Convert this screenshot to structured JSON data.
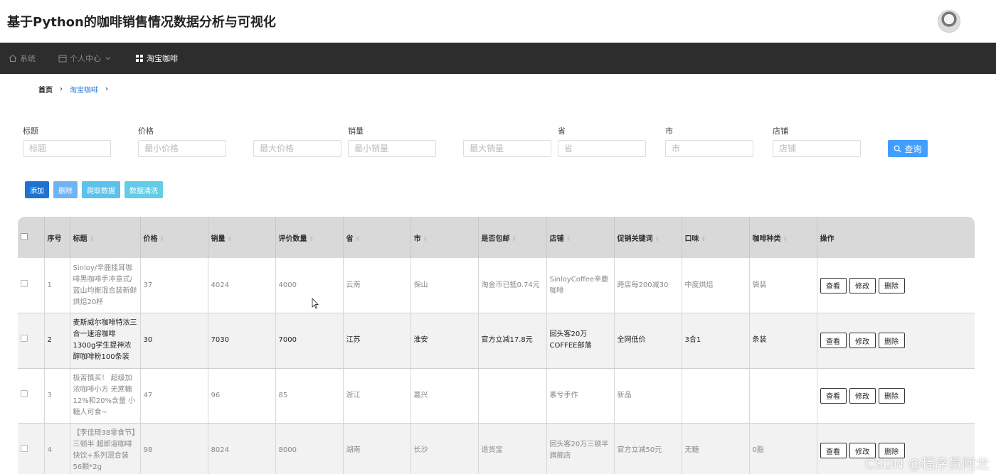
{
  "app": {
    "title": "基于Python的咖啡销售情况数据分析与可视化"
  },
  "nav": {
    "items": [
      {
        "label": "系统",
        "icon": "home-icon"
      },
      {
        "label": "个人中心",
        "icon": "calendar-icon"
      },
      {
        "label": "淘宝咖啡",
        "icon": "grid-icon"
      }
    ]
  },
  "breadcrumb": {
    "home": "首页",
    "current": "淘宝咖啡",
    "sep": "›"
  },
  "filters": {
    "title_label": "标题",
    "title_placeholder": "标题",
    "price_label": "价格",
    "price_min_placeholder": "最小价格",
    "price_max_placeholder": "最大价格",
    "sales_label": "销量",
    "sales_min_placeholder": "最小销量",
    "sales_max_placeholder": "最大销量",
    "province_label": "省",
    "province_placeholder": "省",
    "city_label": "市",
    "city_placeholder": "市",
    "shop_label": "店铺",
    "shop_placeholder": "店铺",
    "search_label": "查询"
  },
  "actions": {
    "add": "添加",
    "delete": "删除",
    "crawl": "爬取数据",
    "clean": "数据清洗"
  },
  "table": {
    "headers": [
      "序号",
      "标题",
      "价格",
      "销量",
      "评价数量",
      "省",
      "市",
      "是否包邮",
      "店铺",
      "促销关键词",
      "口味",
      "咖啡种类",
      "操作"
    ],
    "op_view": "查看",
    "op_edit": "修改",
    "op_delete": "删除",
    "rows": [
      [
        "1",
        "Sinloy/辛鹿挂耳咖啡黑咖啡手冲意式/蓝山均衡混合装新鲜烘焙20杯",
        "37",
        "4024",
        "4000",
        "云南",
        "保山",
        "淘金币已抵0.74元",
        "SinloyCoffee辛鹿咖啡",
        "跨店每200减30",
        "中度烘焙",
        "袋装"
      ],
      [
        "2",
        "麦斯威尔咖啡特浓三合一速溶咖啡1300g学生提神浓醇咖啡粉100条装",
        "30",
        "7030",
        "7000",
        "江苏",
        "淮安",
        "官方立减17.8元",
        "回头客20万COFFEE部落",
        "全网低价",
        "3合1",
        "条装"
      ],
      [
        "3",
        "极苦慎买！ 超级加浓咖啡小方 无蔗糖12%和20%含量 小糖人可食~",
        "47",
        "96",
        "85",
        "浙江",
        "嘉兴",
        "",
        "素兮手作",
        "新品",
        "",
        ""
      ],
      [
        "4",
        "【李佳琦38零食节】三顿半 超即溶咖啡快饮+系列混合装56颗*2g",
        "98",
        "8024",
        "8000",
        "湖南",
        "长沙",
        "退货宝",
        "回头客20万三顿半旗舰店",
        "官方立减50元",
        "无糖",
        "0脂"
      ]
    ]
  },
  "watermark": "CSDN @程序员阿龙"
}
